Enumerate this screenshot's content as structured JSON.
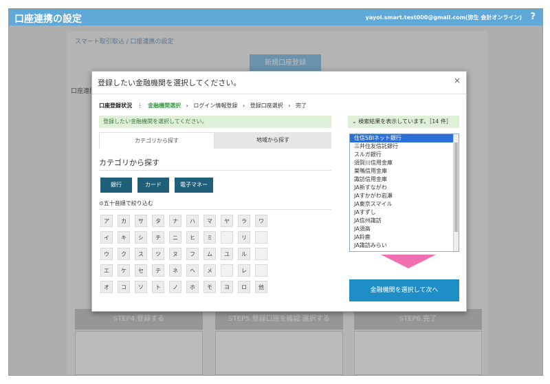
{
  "header": {
    "title": "口座連携の設定",
    "user": "yayoi.smart.test000@gmail.com(弥生 会計オンライン)",
    "help": "?"
  },
  "background": {
    "breadcrumb": "スマート取引取込 / 口座連携の設定",
    "new_button": "新規口座登録",
    "panel_label": "口座連携",
    "step_tiles": [
      "STEP4.登録する",
      "STEP5.登録口座を確認 選択する",
      "STEP6.完了"
    ]
  },
  "modal": {
    "title": "登録したい金融機関を選択してください。",
    "close": "×",
    "progress_label": "口座登録状況",
    "progress_steps": [
      "金融機関選択",
      "ログイン情報登録",
      "登録口座選択",
      "完了"
    ],
    "info": "登録したい金融機関を選択してください。",
    "tabs": [
      "カテゴリから探す",
      "地域から探す"
    ],
    "section_title": "カテゴリから探す",
    "categories": [
      "銀行",
      "カード",
      "電子マネー"
    ],
    "filter_label": "五十音順で絞り込む",
    "kana_rows": [
      [
        "ア",
        "カ",
        "サ",
        "タ",
        "ナ",
        "ハ",
        "マ",
        "ヤ",
        "ラ",
        "ワ"
      ],
      [
        "イ",
        "キ",
        "シ",
        "チ",
        "ニ",
        "ヒ",
        "ミ",
        "",
        "リ",
        ""
      ],
      [
        "ウ",
        "ク",
        "ス",
        "ツ",
        "ヌ",
        "フ",
        "ム",
        "ユ",
        "ル",
        ""
      ],
      [
        "エ",
        "ケ",
        "セ",
        "テ",
        "ネ",
        "ヘ",
        "メ",
        "",
        "レ",
        ""
      ],
      [
        "オ",
        "コ",
        "ソ",
        "ト",
        "ノ",
        "ホ",
        "モ",
        "ヨ",
        "ロ",
        "他"
      ]
    ],
    "result_head": "検索結果を表示しています。［14 件］",
    "banks": [
      "住信SBIネット銀行",
      "三井住友信託銀行",
      "スルガ銀行",
      "須賀川信用金庫",
      "巣鴨信用金庫",
      "諏訪信用金庫",
      "JA新すながわ",
      "JAすかがわ岩瀬",
      "JA東京スマイル",
      "JAすずし",
      "JA信州諏訪",
      "JA須高",
      "JA鈴鹿",
      "JA諏訪みらい"
    ],
    "next_button": "金融機関を選択して次へ"
  }
}
